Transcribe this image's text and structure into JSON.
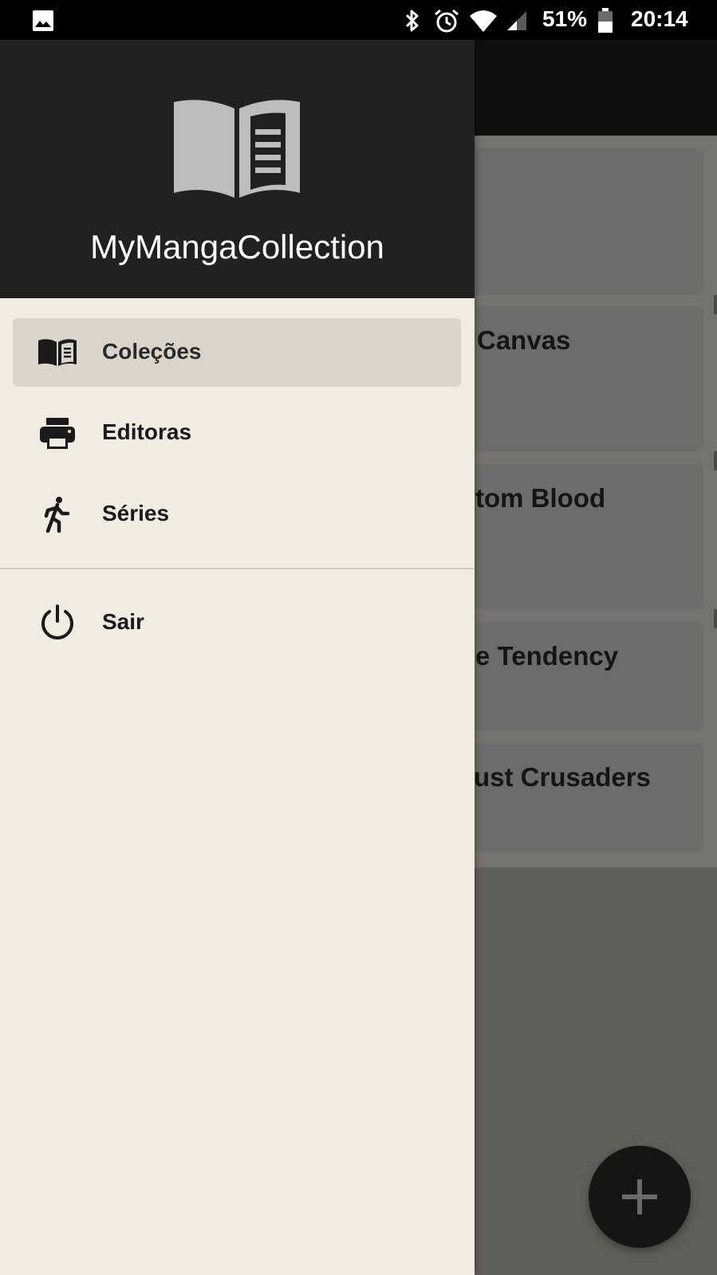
{
  "status_bar": {
    "battery_percent": "51%",
    "time": "20:14",
    "icons": [
      "image-icon",
      "bluetooth-icon",
      "alarm-icon",
      "wifi-icon",
      "cell-signal-icon",
      "battery-icon"
    ]
  },
  "background_list": {
    "cards": [
      {
        "title": ""
      },
      {
        "title": "Canvas"
      },
      {
        "title": "tom Blood"
      },
      {
        "title": "e Tendency"
      },
      {
        "title": "ust Crusaders"
      }
    ]
  },
  "fab": {
    "icon": "plus-icon"
  },
  "drawer": {
    "header": {
      "app_name": "MyMangaCollection",
      "logo_icon": "open-book-icon"
    },
    "items": [
      {
        "label": "Coleções",
        "icon": "book-icon",
        "selected": true
      },
      {
        "label": "Editoras",
        "icon": "printer-icon",
        "selected": false
      },
      {
        "label": "Séries",
        "icon": "running-person-icon",
        "selected": false
      },
      {
        "label": "Sair",
        "icon": "power-icon",
        "selected": false
      }
    ]
  },
  "colors": {
    "drawer_bg": "#f0ece2",
    "drawer_header_bg": "#212121",
    "selected_item_bg": "#d8d5cb",
    "fab_bg": "#151515"
  }
}
